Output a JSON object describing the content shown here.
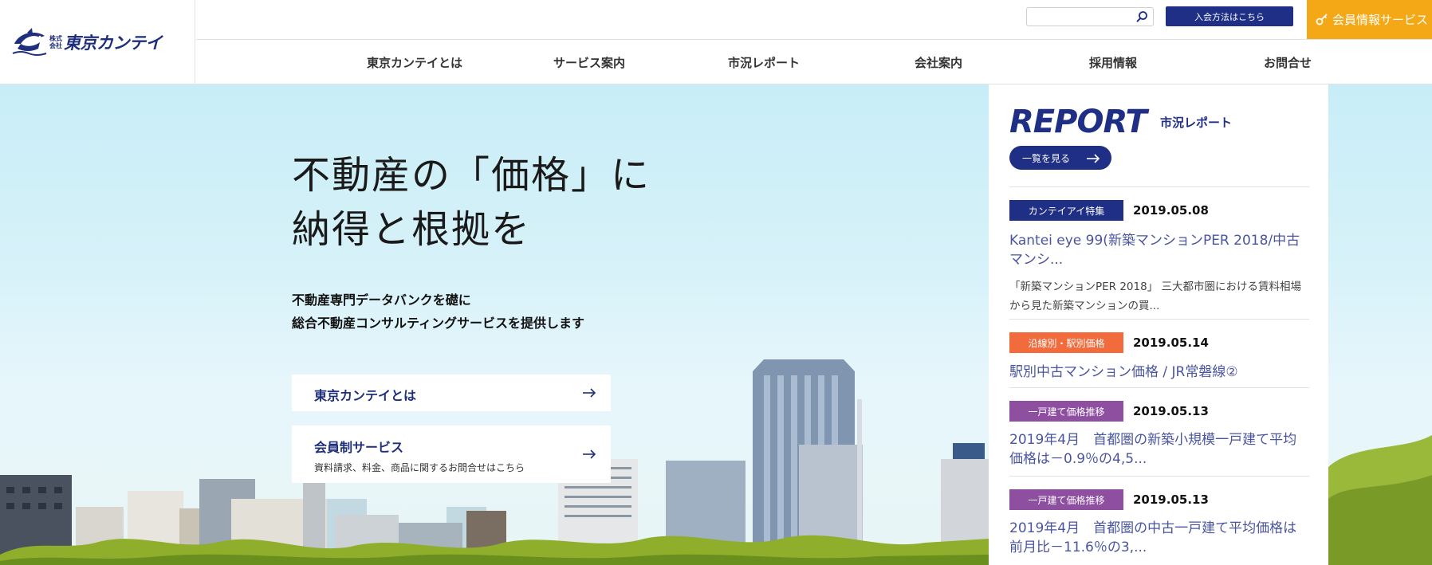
{
  "brand": {
    "company_prefix_line1": "株式",
    "company_prefix_line2": "会社",
    "name": "東京カンテイ",
    "color": "#1f2f7a"
  },
  "topbar": {
    "search_placeholder": "",
    "search_icon": "magnifier-icon",
    "join_label": "入会方法はこちら",
    "member_label": "会員情報サービス",
    "member_icon": "key-icon",
    "join_color": "#1f2f85",
    "member_color": "#f4a816"
  },
  "nav": {
    "items": [
      "東京カンテイとは",
      "サービス案内",
      "市況レポート",
      "会社案内",
      "採用情報",
      "お問合せ"
    ]
  },
  "hero": {
    "headline_line1": "不動産の「価格」に",
    "headline_line2": "納得と根拠を",
    "sub_line1": "不動産専門データバンクを礎に",
    "sub_line2": "総合不動産コンサルティングサービスを提供します",
    "cta1_label": "東京カンテイとは",
    "cta2_label": "会員制サービス",
    "cta2_desc": "資料請求、料金、商品に関するお問合せはこちら"
  },
  "report": {
    "title": "REPORT",
    "subtitle": "市況レポート",
    "view_all": "一覧を見る",
    "items": [
      {
        "tag": "カンテイアイ特集",
        "tag_color": "#1f2f85",
        "date": "2019.05.08",
        "title": "Kantei eye 99(新築マンションPER 2018/中古マンシ...",
        "excerpt": "「新築マンションPER 2018」 三大都市圏における賃料相場から見た新築マンションの買..."
      },
      {
        "tag": "沿線別・駅別価格",
        "tag_color": "#f26b3c",
        "date": "2019.05.14",
        "title": "駅別中古マンション価格 / JR常磐線②",
        "excerpt": ""
      },
      {
        "tag": "一戸建て価格推移",
        "tag_color": "#8e4fa1",
        "date": "2019.05.13",
        "title": "2019年4月　首都圏の新築小規模一戸建て平均価格は－0.9％の4,5...",
        "excerpt": ""
      },
      {
        "tag": "一戸建て価格推移",
        "tag_color": "#8e4fa1",
        "date": "2019.05.13",
        "title": "2019年4月　首都圏の中古一戸建て平均価格は前月比－11.6％の3,...",
        "excerpt": ""
      }
    ]
  }
}
